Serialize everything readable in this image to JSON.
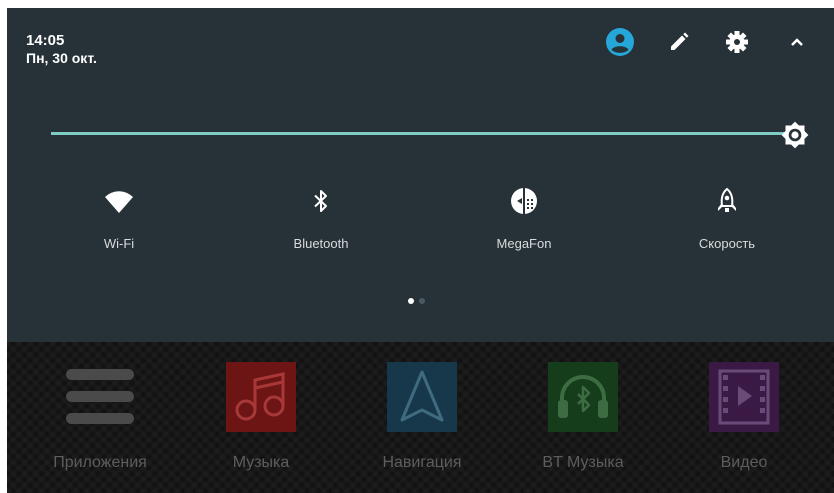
{
  "status": {
    "time": "14:05",
    "date": "Пн, 30 окт."
  },
  "header_icons": [
    "account-icon",
    "edit-pencil-icon",
    "settings-gear-icon",
    "collapse-chevron-icon"
  ],
  "brightness": {
    "level": 1.0,
    "accent": "#80cbc4"
  },
  "quick_settings": [
    {
      "label": "Wi-Fi",
      "icon": "wifi-icon"
    },
    {
      "label": "Bluetooth",
      "icon": "bluetooth-icon"
    },
    {
      "label": "MegaFon",
      "icon": "cellular-data-icon"
    },
    {
      "label": "Скорость",
      "icon": "rocket-icon"
    }
  ],
  "pager": {
    "pages": 2,
    "current": 1
  },
  "launcher": {
    "apps": [
      {
        "label": "Приложения",
        "icon": "apps-menu-icon"
      },
      {
        "label": "Музыка",
        "icon": "music-icon",
        "color": "#6d1515"
      },
      {
        "label": "Навигация",
        "icon": "navigation-icon",
        "color": "#17384a"
      },
      {
        "label": "BT Музыка",
        "icon": "bt-headphones-icon",
        "color": "#163d1b"
      },
      {
        "label": "Видео",
        "icon": "video-icon",
        "color": "#3a1a44"
      }
    ]
  },
  "colors": {
    "shade_bg": "#263238",
    "launcher_bg": "#121212",
    "account_accent": "#26a7d9"
  }
}
